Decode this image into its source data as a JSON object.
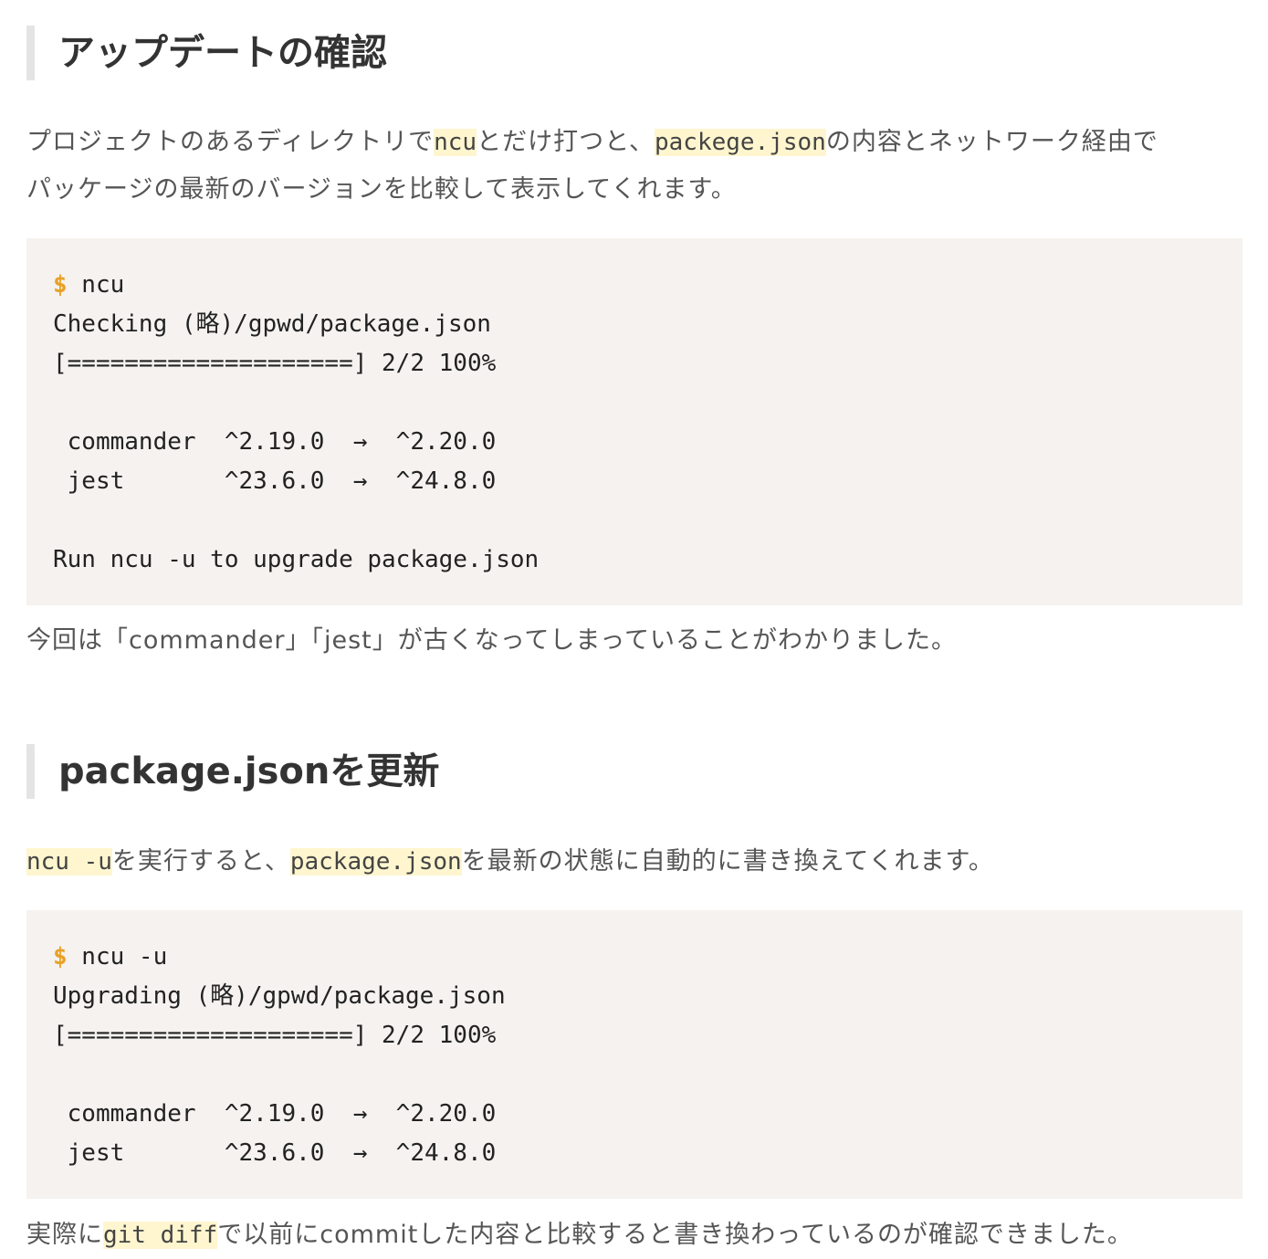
{
  "section1": {
    "heading": "アップデートの確認",
    "intro": {
      "t1": "プロジェクトのあるディレクトリで",
      "c1": "ncu",
      "t2": "とだけ打つと、",
      "c2": "packege.json",
      "t3": "の内容とネットワーク経由で",
      "line2": "パッケージの最新のバージョンを比較して表示してくれます。"
    },
    "code": {
      "prompt": "$",
      "command": " ncu",
      "lines": [
        "Checking (略)/gpwd/package.json",
        "[====================] 2/2 100%",
        "",
        " commander  ^2.19.0  →  ^2.20.0",
        " jest       ^23.6.0  →  ^24.8.0",
        "",
        "Run ncu -u to upgrade package.json"
      ]
    },
    "outro": "今回は「commander」「jest」が古くなってしまっていることがわかりました。"
  },
  "section2": {
    "heading": "package.jsonを更新",
    "intro": {
      "c1": "ncu -u",
      "t1": "を実行すると、",
      "c2": "package.json",
      "t2": "を最新の状態に自動的に書き換えてくれます。"
    },
    "code": {
      "prompt": "$",
      "command": " ncu -u",
      "lines": [
        "Upgrading (略)/gpwd/package.json",
        "[====================] 2/2 100%",
        "",
        " commander  ^2.19.0  →  ^2.20.0",
        " jest       ^23.6.0  →  ^24.8.0"
      ]
    },
    "outro": {
      "t1": "実際に",
      "c1": "git diff",
      "t2": "で以前にcommitした内容と比較すると書き換わっているのが確認できました。"
    }
  },
  "colors": {
    "prompt": "#e8a126",
    "code_bg": "#f5f2ef",
    "highlight_bg": "#fff6cf",
    "heading_border": "#e4e4e4"
  }
}
